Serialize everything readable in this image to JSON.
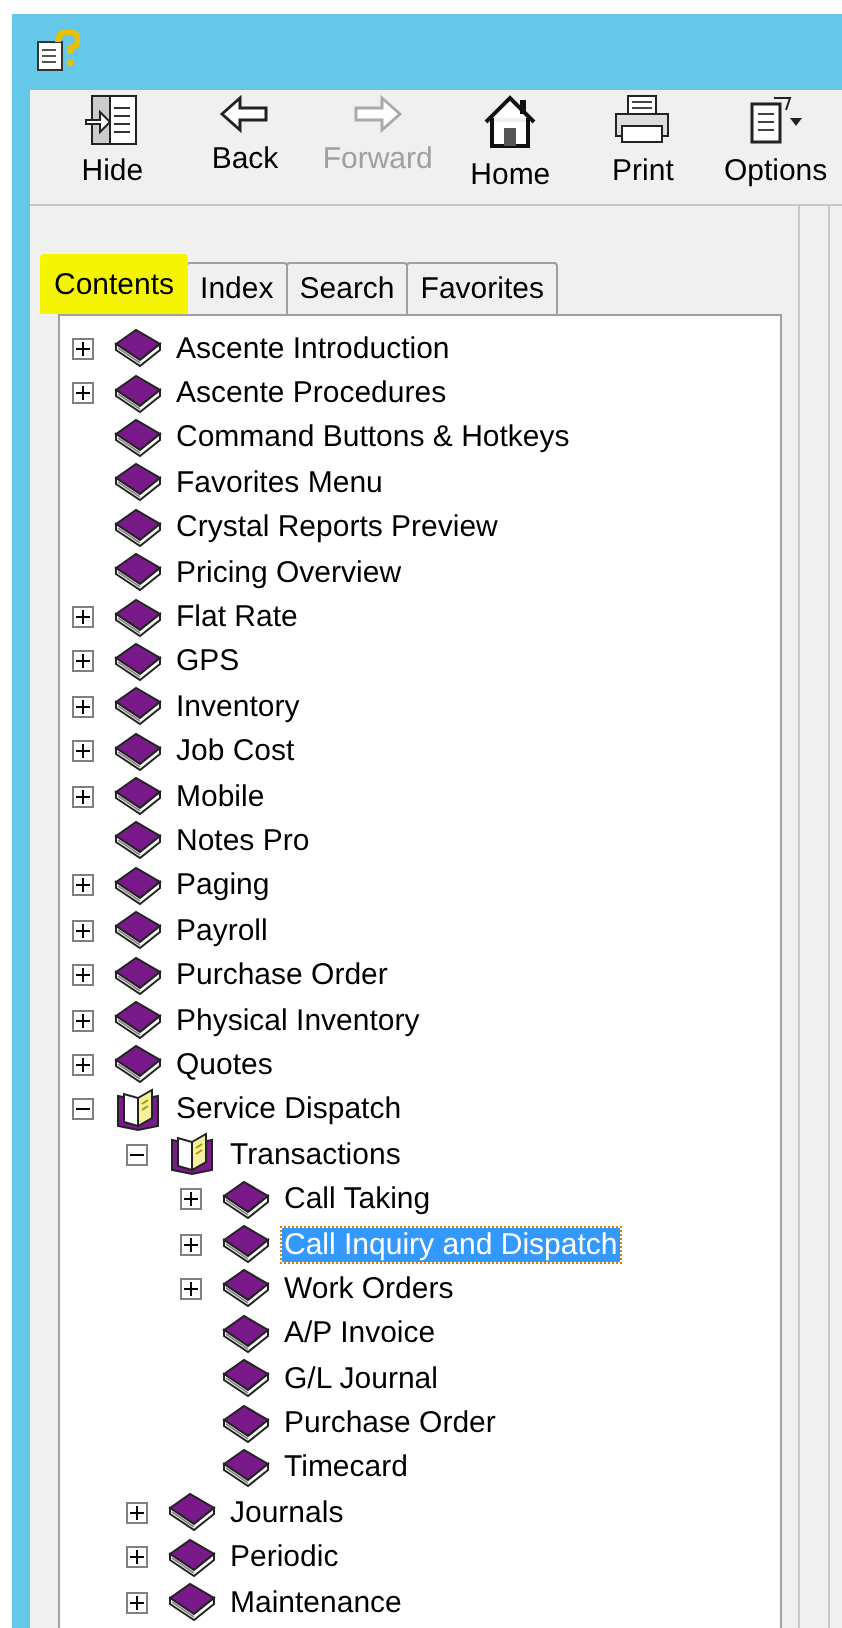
{
  "toolbar": [
    {
      "label": "Hide",
      "kind": "hide",
      "disabled": false
    },
    {
      "label": "Back",
      "kind": "back",
      "disabled": false
    },
    {
      "label": "Forward",
      "kind": "forward",
      "disabled": true
    },
    {
      "label": "Home",
      "kind": "home",
      "disabled": false
    },
    {
      "label": "Print",
      "kind": "print",
      "disabled": false
    },
    {
      "label": "Options",
      "kind": "options",
      "disabled": false
    }
  ],
  "tabs": [
    {
      "label": "Contents",
      "selected": true,
      "highlighted": true
    },
    {
      "label": "Index",
      "selected": false,
      "highlighted": false
    },
    {
      "label": "Search",
      "selected": false,
      "highlighted": false
    },
    {
      "label": "Favorites",
      "selected": false,
      "highlighted": false
    }
  ],
  "tree": [
    {
      "label": "Ascente Introduction",
      "expandable": true,
      "expanded": false,
      "selected": false
    },
    {
      "label": "Ascente Procedures",
      "expandable": true,
      "expanded": false,
      "selected": false
    },
    {
      "label": "Command Buttons & Hotkeys",
      "expandable": false,
      "expanded": false,
      "selected": false
    },
    {
      "label": "Favorites Menu",
      "expandable": false,
      "expanded": false,
      "selected": false
    },
    {
      "label": "Crystal Reports Preview",
      "expandable": false,
      "expanded": false,
      "selected": false
    },
    {
      "label": "Pricing Overview",
      "expandable": false,
      "expanded": false,
      "selected": false
    },
    {
      "label": "Flat Rate",
      "expandable": true,
      "expanded": false,
      "selected": false
    },
    {
      "label": "GPS",
      "expandable": true,
      "expanded": false,
      "selected": false
    },
    {
      "label": "Inventory",
      "expandable": true,
      "expanded": false,
      "selected": false
    },
    {
      "label": "Job Cost",
      "expandable": true,
      "expanded": false,
      "selected": false
    },
    {
      "label": "Mobile",
      "expandable": true,
      "expanded": false,
      "selected": false
    },
    {
      "label": "Notes Pro",
      "expandable": false,
      "expanded": false,
      "selected": false
    },
    {
      "label": "Paging",
      "expandable": true,
      "expanded": false,
      "selected": false
    },
    {
      "label": "Payroll",
      "expandable": true,
      "expanded": false,
      "selected": false
    },
    {
      "label": "Purchase Order",
      "expandable": true,
      "expanded": false,
      "selected": false
    },
    {
      "label": "Physical Inventory",
      "expandable": true,
      "expanded": false,
      "selected": false
    },
    {
      "label": "Quotes",
      "expandable": true,
      "expanded": false,
      "selected": false
    },
    {
      "label": "Service Dispatch",
      "expandable": true,
      "expanded": true,
      "selected": false,
      "children": [
        {
          "label": "Transactions",
          "expandable": true,
          "expanded": true,
          "selected": false,
          "children": [
            {
              "label": "Call Taking",
              "expandable": true,
              "expanded": false,
              "selected": false
            },
            {
              "label": "Call Inquiry and Dispatch",
              "expandable": true,
              "expanded": false,
              "selected": true
            },
            {
              "label": "Work Orders",
              "expandable": true,
              "expanded": false,
              "selected": false
            },
            {
              "label": "A/P Invoice",
              "expandable": false,
              "expanded": false,
              "selected": false
            },
            {
              "label": "G/L Journal",
              "expandable": false,
              "expanded": false,
              "selected": false
            },
            {
              "label": "Purchase Order",
              "expandable": false,
              "expanded": false,
              "selected": false
            },
            {
              "label": "Timecard",
              "expandable": false,
              "expanded": false,
              "selected": false
            }
          ]
        },
        {
          "label": "Journals",
          "expandable": true,
          "expanded": false,
          "selected": false
        },
        {
          "label": "Periodic",
          "expandable": true,
          "expanded": false,
          "selected": false
        },
        {
          "label": "Maintenance",
          "expandable": true,
          "expanded": false,
          "selected": false
        }
      ]
    }
  ]
}
